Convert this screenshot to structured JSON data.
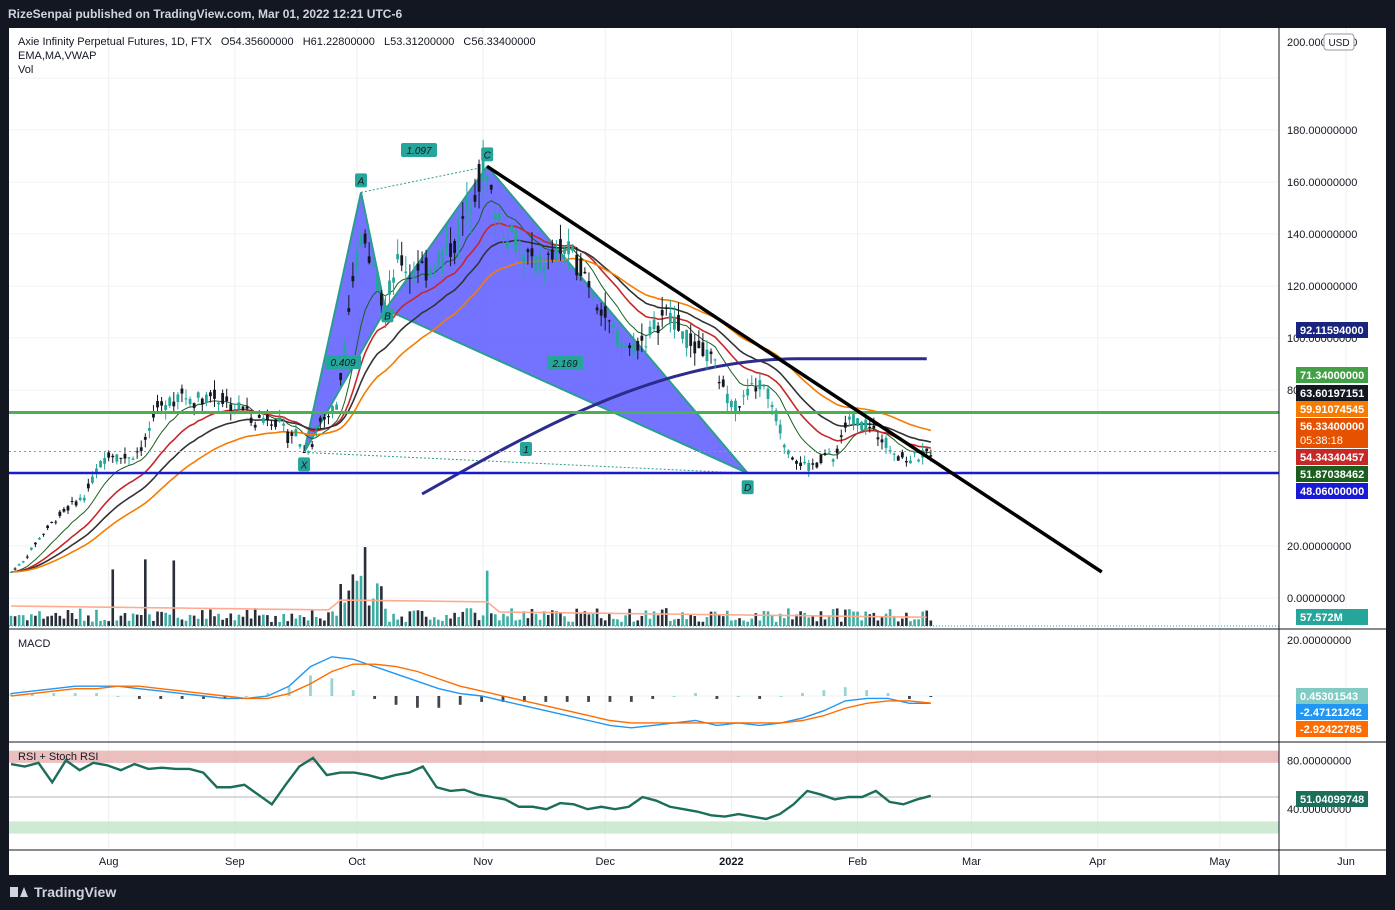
{
  "header": {
    "publisher_line": "RizeSenpai published on TradingView.com, Mar 01, 2022 12:21 UTC-6"
  },
  "legend": {
    "symbol": "Axie Infinity Perpetual Futures, 1D, FTX",
    "ohlc": {
      "o": "O54.35600000",
      "h": "H61.22800000",
      "l": "L53.31200000",
      "c": "C56.33400000"
    },
    "indicators": "EMA,MA,VWAP",
    "vol": "Vol"
  },
  "footer": {
    "brand": "TradingView"
  },
  "colors": {
    "up": "#26a69a",
    "down": "#131722",
    "pattern_fill": "#5b5bff",
    "pattern_edge": "#2a9d8f",
    "resistance_green": "#4caf50",
    "support_blue": "#1a1ad4",
    "vwap": "#2c2c8c",
    "ema_thin": "#1b5e20",
    "ema_red": "#c62828",
    "ema_orange": "#f57c00",
    "ma_black": "#333333",
    "macd": "#2196f3",
    "signal": "#ff6d00",
    "rsi": "#1b6e5a",
    "stoch_band_top": "#e6a9a9",
    "stoch_band_bottom": "#bfe3c4"
  },
  "chart_data": [
    {
      "type": "candlestick",
      "pane": "price",
      "currency_badge": "USD",
      "y_ticks": [
        "200.00000000",
        "180.00000000",
        "160.00000000",
        "140.00000000",
        "120.00000000",
        "100.00000000",
        "80.00000000",
        "20.00000000",
        "0.00000000"
      ],
      "x_ticks": [
        "Aug",
        "Sep",
        "Oct",
        "Nov",
        "Dec",
        "2022",
        "Feb",
        "Mar",
        "Apr",
        "May",
        "Jun"
      ],
      "price_path": [
        [
          0,
          10
        ],
        [
          3,
          14
        ],
        [
          6,
          21
        ],
        [
          9,
          27
        ],
        [
          12,
          32
        ],
        [
          15,
          36
        ],
        [
          18,
          39
        ],
        [
          21,
          49
        ],
        [
          24,
          56
        ],
        [
          27,
          54
        ],
        [
          30,
          55
        ],
        [
          33,
          60
        ],
        [
          36,
          73
        ],
        [
          39,
          76
        ],
        [
          42,
          78
        ],
        [
          45,
          76
        ],
        [
          48,
          78
        ],
        [
          51,
          77
        ],
        [
          54,
          74
        ],
        [
          57,
          73
        ],
        [
          60,
          68
        ],
        [
          63,
          70
        ],
        [
          66,
          67
        ],
        [
          68,
          62
        ],
        [
          70,
          64
        ],
        [
          72,
          56
        ],
        [
          74,
          60
        ],
        [
          76,
          68
        ],
        [
          78,
          70
        ],
        [
          80,
          75
        ],
        [
          82,
          95
        ],
        [
          84,
          120
        ],
        [
          86,
          140
        ],
        [
          88,
          130
        ],
        [
          90,
          120
        ],
        [
          92,
          112
        ],
        [
          94,
          125
        ],
        [
          96,
          130
        ],
        [
          98,
          125
        ],
        [
          100,
          128
        ],
        [
          102,
          126
        ],
        [
          104,
          130
        ],
        [
          106,
          132
        ],
        [
          108,
          135
        ],
        [
          110,
          140
        ],
        [
          112,
          150
        ],
        [
          114,
          158
        ],
        [
          116,
          165
        ],
        [
          118,
          155
        ],
        [
          120,
          145
        ],
        [
          122,
          140
        ],
        [
          124,
          138
        ],
        [
          126,
          132
        ],
        [
          128,
          130
        ],
        [
          130,
          128
        ],
        [
          132,
          130
        ],
        [
          134,
          132
        ],
        [
          136,
          135
        ],
        [
          138,
          130
        ],
        [
          140,
          128
        ],
        [
          142,
          122
        ],
        [
          144,
          115
        ],
        [
          146,
          108
        ],
        [
          148,
          102
        ],
        [
          150,
          98
        ],
        [
          152,
          96
        ],
        [
          154,
          98
        ],
        [
          156,
          100
        ],
        [
          158,
          104
        ],
        [
          160,
          108
        ],
        [
          162,
          110
        ],
        [
          164,
          105
        ],
        [
          166,
          100
        ],
        [
          168,
          96
        ],
        [
          170,
          95
        ],
        [
          172,
          92
        ],
        [
          174,
          85
        ],
        [
          176,
          78
        ],
        [
          178,
          74
        ],
        [
          180,
          76
        ],
        [
          182,
          80
        ],
        [
          184,
          82
        ],
        [
          186,
          78
        ],
        [
          188,
          70
        ],
        [
          190,
          60
        ],
        [
          192,
          55
        ],
        [
          194,
          52
        ],
        [
          196,
          50
        ],
        [
          198,
          52
        ],
        [
          200,
          55
        ],
        [
          202,
          53
        ],
        [
          204,
          62
        ],
        [
          206,
          70
        ],
        [
          208,
          68
        ],
        [
          210,
          66
        ],
        [
          212,
          64
        ],
        [
          214,
          62
        ],
        [
          216,
          58
        ],
        [
          218,
          55
        ],
        [
          220,
          53
        ],
        [
          222,
          54
        ],
        [
          224,
          55
        ],
        [
          226,
          56.3
        ]
      ],
      "volume_last": "57.572M",
      "harmonic_pattern": {
        "points": [
          {
            "label": "X",
            "day": 72,
            "price": 56
          },
          {
            "label": "A",
            "day": 86,
            "price": 156
          },
          {
            "label": "B",
            "day": 92,
            "price": 111
          },
          {
            "label": "C",
            "day": 117,
            "price": 166
          },
          {
            "label": "D",
            "day": 181,
            "price": 48
          }
        ],
        "ratios": [
          {
            "label": "1.097",
            "between": "A-C"
          },
          {
            "label": "0.409",
            "between": "X-B"
          },
          {
            "label": "2.169",
            "between": "B-D"
          }
        ],
        "midpoint_marker": "1"
      },
      "horizontal_lines": [
        {
          "name": "resistance",
          "value": 71.34
        },
        {
          "name": "support",
          "value": 48.06
        }
      ],
      "trendline": {
        "from": {
          "day": 117,
          "price": 166
        },
        "to": {
          "day": 268,
          "price": 10
        }
      },
      "price_labels": [
        {
          "value": "92.11594000",
          "color": "#1a237e"
        },
        {
          "value": "71.34000000",
          "color": "#43a047"
        },
        {
          "value": "63.60197151",
          "color": "#131722"
        },
        {
          "value": "59.91074545",
          "color": "#f57c00"
        },
        {
          "value": "56.33400000",
          "color": "#e65100",
          "sub": "05:38:18"
        },
        {
          "value": "54.34340457",
          "color": "#c62828"
        },
        {
          "value": "51.87038462",
          "color": "#1b5e20"
        },
        {
          "value": "48.06000000",
          "color": "#1a1ad4"
        },
        {
          "value": "57.572M",
          "color": "#26a69a"
        }
      ]
    },
    {
      "type": "line",
      "pane": "macd",
      "title": "MACD",
      "y_ticks": [
        "20.00000000"
      ],
      "series": [
        {
          "name": "MACD",
          "values": [
            1,
            2,
            3,
            4,
            4,
            4,
            3,
            2,
            1,
            0,
            -1,
            -1,
            0,
            4,
            12,
            16,
            15,
            12,
            9,
            6,
            3,
            1,
            0,
            -2,
            -4,
            -6,
            -8,
            -10,
            -12,
            -13,
            -12,
            -11,
            -10,
            -12,
            -11,
            -12,
            -11,
            -9,
            -6,
            -2,
            -1,
            -1,
            -3,
            -3
          ]
        },
        {
          "name": "Signal",
          "values": [
            0,
            1,
            2,
            3,
            3,
            4,
            4,
            3,
            2,
            1,
            0,
            -1,
            -1,
            1,
            5,
            10,
            13,
            13,
            12,
            10,
            7,
            4,
            2,
            0,
            -2,
            -4,
            -6,
            -8,
            -10,
            -11,
            -11,
            -11,
            -11,
            -11,
            -11,
            -11,
            -11,
            -10,
            -8,
            -5,
            -3,
            -2,
            -2,
            -2.9
          ]
        }
      ],
      "last_values": [
        "0.45301543",
        "-2.47121242",
        "-2.92422785"
      ]
    },
    {
      "type": "line",
      "pane": "rsi",
      "title": "RSI + Stoch RSI",
      "y_ticks": [
        "80.00000000",
        "40.00000000"
      ],
      "series": [
        {
          "name": "RSI",
          "values": [
            77,
            75,
            78,
            62,
            80,
            72,
            78,
            76,
            72,
            77,
            73,
            74,
            73,
            73,
            70,
            58,
            58,
            60,
            52,
            44,
            60,
            75,
            82,
            68,
            70,
            70,
            68,
            65,
            68,
            70,
            75,
            58,
            55,
            56,
            52,
            50,
            48,
            42,
            42,
            40,
            45,
            44,
            40,
            42,
            40,
            42,
            50,
            47,
            42,
            40,
            38,
            35,
            34,
            36,
            34,
            32,
            36,
            44,
            55,
            52,
            48,
            50,
            50,
            55,
            46,
            44,
            48,
            51
          ]
        }
      ],
      "last_value": "51.04099748"
    }
  ]
}
